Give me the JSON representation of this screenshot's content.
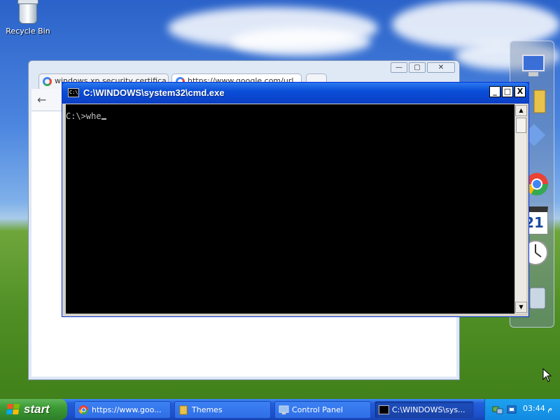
{
  "desktop": {
    "recycle_bin_label": "Recycle Bin"
  },
  "chrome": {
    "tabs": [
      {
        "title": "windows xp security certifica"
      },
      {
        "title": "https://www.google.com/url"
      }
    ],
    "controls": {
      "minimize": "—",
      "maximize": "▢",
      "close": "✕"
    },
    "back_glyph": "←"
  },
  "cmd": {
    "title": "C:\\WINDOWS\\system32\\cmd.exe",
    "icon_text": "C:\\",
    "buttons": {
      "minimize": "_",
      "maximize": "□",
      "close": "X"
    },
    "prompt": "C:\\>",
    "typed": "whe",
    "scroll_up": "▲",
    "scroll_down": "▼"
  },
  "sidebar": {
    "gadgets": [
      "monitor-gadget",
      "folder-gadget",
      "chrome-gadget",
      "calendar-gadget",
      "clock-gadget",
      "recycle-gadget"
    ],
    "calendar_day": "21"
  },
  "taskbar": {
    "start_label": "start",
    "tasks": [
      {
        "label": "https://www.goo...",
        "icon": "chrome-icon"
      },
      {
        "label": "Themes",
        "icon": "folder-icon"
      },
      {
        "label": "Control Panel",
        "icon": "control-panel-icon"
      },
      {
        "label": "C:\\WINDOWS\\sys...",
        "icon": "cmd-icon",
        "active": true
      }
    ],
    "clock": "03:44 م"
  },
  "colors": {
    "titlebar": "#0a4ed8",
    "taskbar": "#245edb",
    "start": "#3c9a34",
    "console_bg": "#000000",
    "console_fg": "#c0c0c0"
  }
}
